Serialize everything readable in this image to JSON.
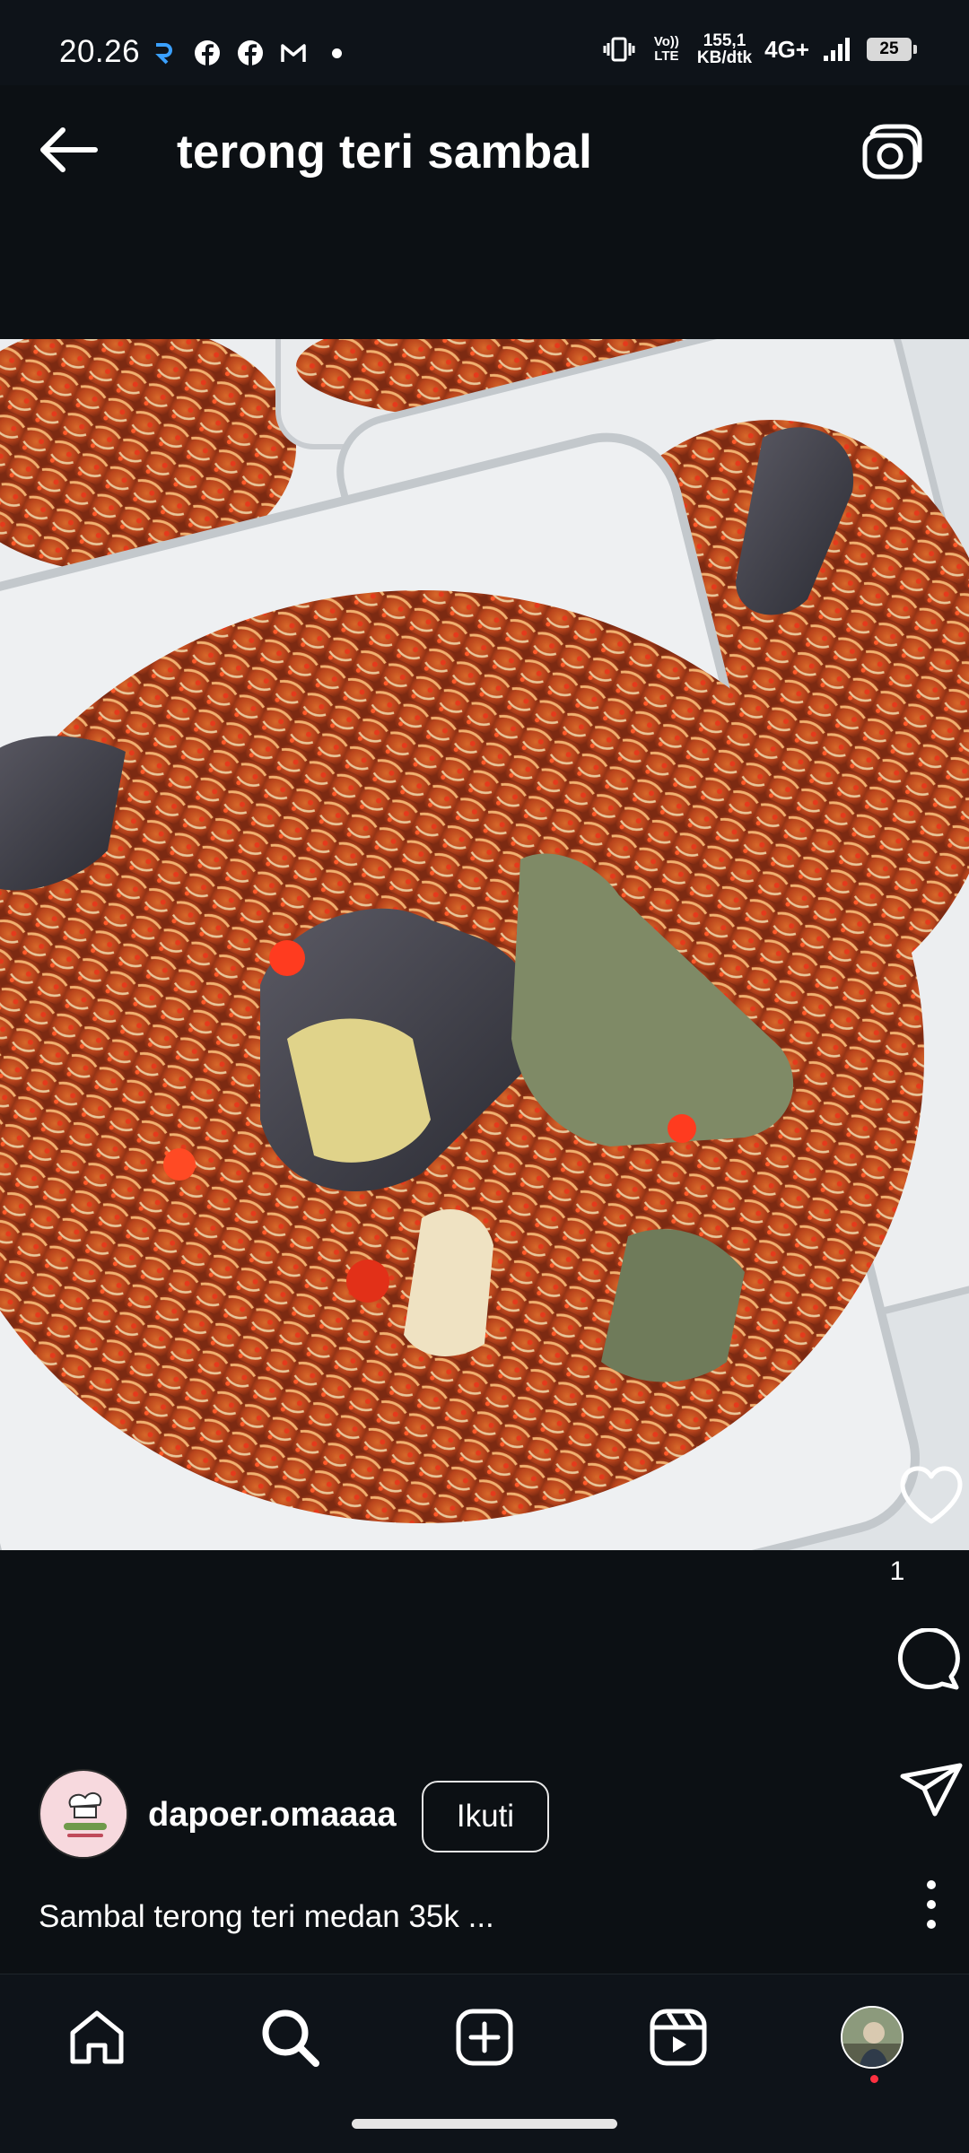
{
  "status_bar": {
    "time": "20.26",
    "left_icons": [
      "screen-record-icon",
      "facebook-icon",
      "facebook-icon",
      "gmail-icon"
    ],
    "network_speed_value": "155,1",
    "network_speed_unit": "KB/dtk",
    "volte_label": "Vo)) LTE",
    "network_type": "4G+",
    "battery_level": "25"
  },
  "header": {
    "title": "terong teri sambal",
    "back_icon": "back-arrow-icon",
    "camera_icon": "camera-icon"
  },
  "post": {
    "image_description_icon": "food-photo",
    "like_count": "1",
    "author": {
      "username": "dapoer.omaaaa",
      "follow_label": "Ikuti"
    },
    "caption": "Sambal terong teri medan 35k ..."
  },
  "colors": {
    "background": "#0c1014",
    "notification_dot": "#ff3040",
    "text": "#ffffff"
  },
  "bottom_nav": {
    "items": [
      "home-icon",
      "search-icon",
      "create-icon",
      "reels-icon",
      "profile-avatar"
    ]
  }
}
